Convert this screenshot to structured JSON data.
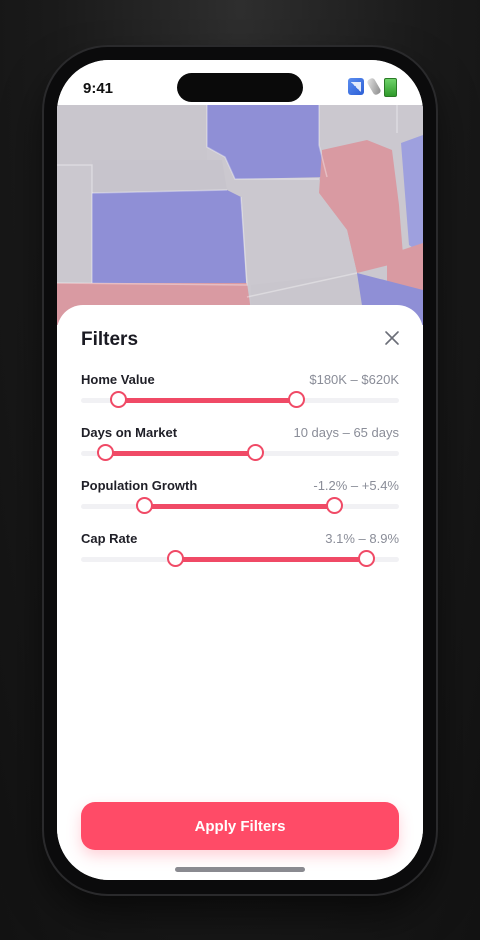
{
  "status_bar": {
    "time": "9:41",
    "icons": [
      "signal-icon",
      "flashlight-icon",
      "battery-icon"
    ]
  },
  "map": {
    "region_colors": {
      "blue": "#8f8fd6",
      "red": "#d99aa2",
      "neutral": "#cbc8cf"
    }
  },
  "sheet": {
    "title": "Filters",
    "close_icon": "close-icon"
  },
  "filters": [
    {
      "label": "Home Value",
      "range_text": "$180K – $620K",
      "low": 0.12,
      "high": 0.68
    },
    {
      "label": "Days on Market",
      "range_text": "10 days – 65 days",
      "low": 0.08,
      "high": 0.55
    },
    {
      "label": "Population Growth",
      "range_text": "-1.2% – +5.4%",
      "low": 0.2,
      "high": 0.8
    },
    {
      "label": "Cap Rate",
      "range_text": "3.1% – 8.9%",
      "low": 0.3,
      "high": 0.9
    }
  ],
  "apply_button": {
    "label": "Apply Filters"
  },
  "colors": {
    "accent": "#f04a66",
    "button": "#ff4b67",
    "track": "#f1f1f4"
  }
}
